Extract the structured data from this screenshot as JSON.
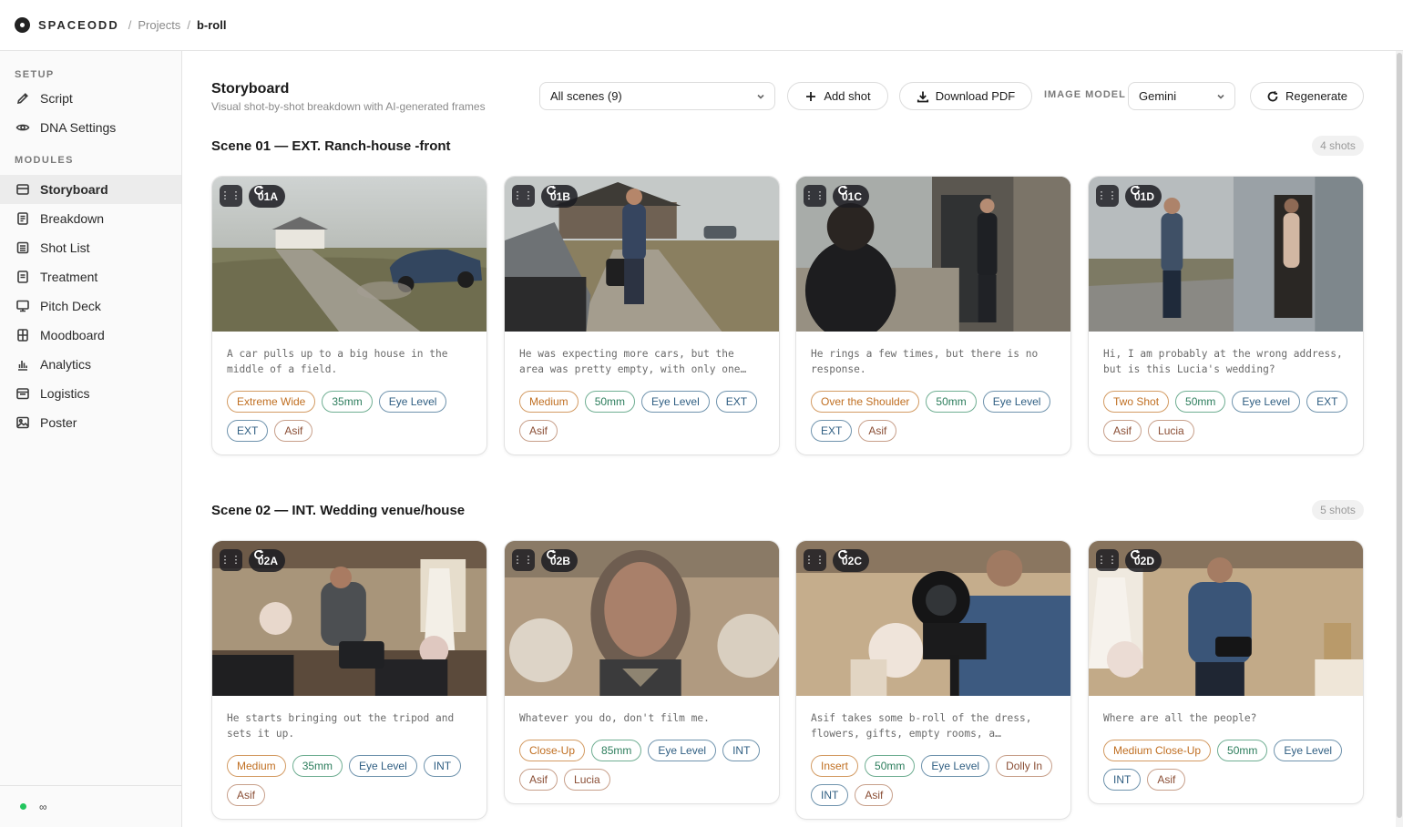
{
  "topbar": {
    "brand": "SPACEODD",
    "sep": "/",
    "crumbs": [
      "Projects",
      "b-roll"
    ]
  },
  "sidebar": {
    "setup_label": "SETUP",
    "setup_items": [
      {
        "label": "Script",
        "icon": "pencil-icon"
      },
      {
        "label": "DNA Settings",
        "icon": "eye-icon"
      }
    ],
    "modules_label": "MODULES",
    "module_items": [
      {
        "label": "Storyboard",
        "icon": "storyboard-icon",
        "active": true
      },
      {
        "label": "Breakdown",
        "icon": "breakdown-icon"
      },
      {
        "label": "Shot List",
        "icon": "list-icon"
      },
      {
        "label": "Treatment",
        "icon": "document-icon"
      },
      {
        "label": "Pitch Deck",
        "icon": "monitor-icon"
      },
      {
        "label": "Moodboard",
        "icon": "grid-icon"
      },
      {
        "label": "Analytics",
        "icon": "chart-icon"
      },
      {
        "label": "Logistics",
        "icon": "calendar-icon"
      },
      {
        "label": "Poster",
        "icon": "image-icon"
      }
    ],
    "footer": {
      "status_color": "#22c55e",
      "symbol": "∞"
    }
  },
  "header": {
    "title": "Storyboard",
    "subtitle": "Visual shot-by-shot breakdown with AI-generated frames",
    "scene_filter": "All scenes (9)",
    "add_shot": "Add shot",
    "download_pdf": "Download PDF",
    "image_model_label": "IMAGE MODEL",
    "image_model": "Gemini",
    "regenerate": "Regenerate"
  },
  "colors": {
    "accent_orange": "#c06f22",
    "accent_green": "#2c7d5c",
    "accent_blue": "#2f5e82",
    "accent_brown": "#8a4e35"
  },
  "scenes": [
    {
      "title": "Scene 01 — EXT. Ranch-house -front",
      "count": "4 shots",
      "shots": [
        {
          "id": "01A",
          "desc": "A car pulls up to a big house in the middle of a field.",
          "tags": [
            [
              "Extreme Wide",
              "o"
            ],
            [
              "35mm",
              "g"
            ],
            [
              "Eye Level",
              "b"
            ],
            [
              "EXT",
              "b"
            ],
            [
              "Asif",
              "r"
            ]
          ]
        },
        {
          "id": "01B",
          "desc": "He was expecting more cars, but the area was pretty empty, with only one…",
          "tags": [
            [
              "Medium",
              "o"
            ],
            [
              "50mm",
              "g"
            ],
            [
              "Eye Level",
              "b"
            ],
            [
              "EXT",
              "b"
            ],
            [
              "Asif",
              "r"
            ]
          ]
        },
        {
          "id": "01C",
          "desc": "He rings a few times, but there is no response.",
          "tags": [
            [
              "Over the Shoulder",
              "o"
            ],
            [
              "50mm",
              "g"
            ],
            [
              "Eye Level",
              "b"
            ],
            [
              "EXT",
              "b"
            ],
            [
              "Asif",
              "r"
            ]
          ]
        },
        {
          "id": "01D",
          "desc": "Hi, I am probably at the wrong address, but is this Lucia's wedding?",
          "tags": [
            [
              "Two Shot",
              "o"
            ],
            [
              "50mm",
              "g"
            ],
            [
              "Eye Level",
              "b"
            ],
            [
              "EXT",
              "b"
            ],
            [
              "Asif",
              "r"
            ],
            [
              "Lucia",
              "r"
            ]
          ]
        }
      ]
    },
    {
      "title": "Scene 02 — INT. Wedding venue/house",
      "count": "5 shots",
      "shots": [
        {
          "id": "02A",
          "desc": "He starts bringing out the tripod and sets it up.",
          "tags": [
            [
              "Medium",
              "o"
            ],
            [
              "35mm",
              "g"
            ],
            [
              "Eye Level",
              "b"
            ],
            [
              "INT",
              "b"
            ],
            [
              "Asif",
              "r"
            ]
          ]
        },
        {
          "id": "02B",
          "desc": "Whatever you do, don't film me.",
          "tags": [
            [
              "Close-Up",
              "o"
            ],
            [
              "85mm",
              "g"
            ],
            [
              "Eye Level",
              "b"
            ],
            [
              "INT",
              "b"
            ],
            [
              "Asif",
              "r"
            ],
            [
              "Lucia",
              "r"
            ]
          ]
        },
        {
          "id": "02C",
          "desc": "Asif takes some b-roll of the dress, flowers, gifts, empty rooms, a…",
          "tags": [
            [
              "Insert",
              "o"
            ],
            [
              "50mm",
              "g"
            ],
            [
              "Eye Level",
              "b"
            ],
            [
              "Dolly In",
              "r"
            ],
            [
              "INT",
              "b"
            ],
            [
              "Asif",
              "r"
            ]
          ]
        },
        {
          "id": "02D",
          "desc": "Where are all the people?",
          "tags": [
            [
              "Medium Close-Up",
              "o"
            ],
            [
              "50mm",
              "g"
            ],
            [
              "Eye Level",
              "b"
            ],
            [
              "INT",
              "b"
            ],
            [
              "Asif",
              "r"
            ]
          ]
        }
      ]
    }
  ]
}
